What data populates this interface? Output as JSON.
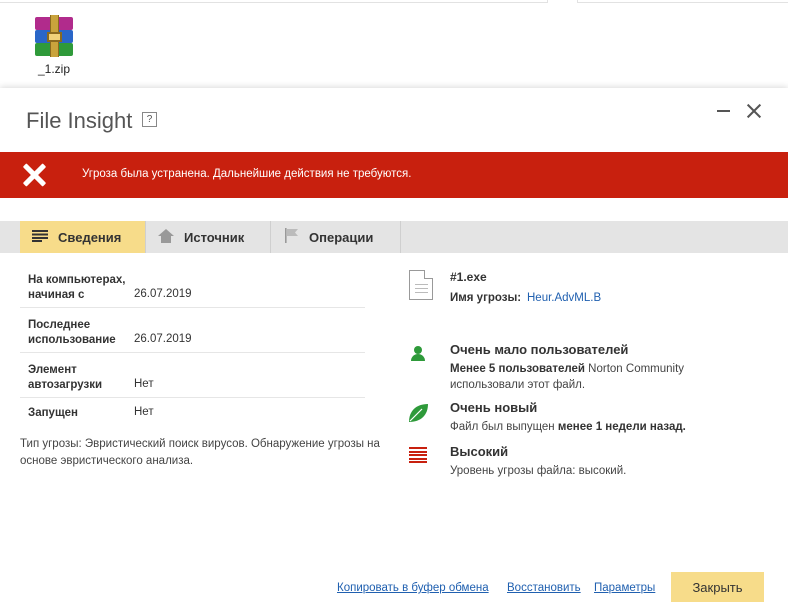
{
  "desktop": {
    "file_name": "_1.zip",
    "file_icon": "winrar-archive-icon"
  },
  "dialog": {
    "title": "File Insight",
    "help": "?",
    "alert_text": "Угроза была устранена. Дальнейшие действия не требуются.",
    "alert_color": "#c8200e",
    "tabs": [
      {
        "label": "Сведения",
        "icon": "list-icon",
        "active": true
      },
      {
        "label": "Источник",
        "icon": "home-icon"
      },
      {
        "label": "Операции",
        "icon": "flag-icon"
      }
    ],
    "details": [
      {
        "label_line1": "На компьютерах,",
        "label_line2": "начиная с",
        "value": "26.07.2019"
      },
      {
        "label_line1": "Последнее",
        "label_line2": "использование",
        "value": "26.07.2019"
      },
      {
        "label_line1": "Элемент",
        "label_line2": "автозагрузки",
        "value": "Нет"
      },
      {
        "label_line1": "Запущен",
        "label_line2": "",
        "value": "Нет"
      }
    ],
    "threat_note": "Тип угрозы: Эвристический поиск вирусов. Обнаружение угрозы на основе эвристического анализа.",
    "file": {
      "name": "#1.exe",
      "threat_label": "Имя угрозы:",
      "threat_name": "Heur.AdvML.B"
    },
    "indicators": [
      {
        "icon": "user-icon",
        "heading": "Очень мало пользователей",
        "desc_bold": "Менее 5 пользователей",
        "desc": " Norton Community использовали этот файл.",
        "color": "#2e9a3a"
      },
      {
        "icon": "leaf-icon",
        "heading": "Очень новый",
        "desc": "Файл был выпущен ",
        "desc_bold": "менее 1 недели назад.",
        "color": "#2e9a3a"
      },
      {
        "icon": "threat-bars-icon",
        "heading": "Высокий",
        "desc": "Уровень угрозы файла: высокий.",
        "color": "#c8200e"
      }
    ],
    "footer": {
      "copy": "Копировать в буфер обмена",
      "restore": "Восстановить",
      "params": "Параметры",
      "close": "Закрыть"
    },
    "accent_color": "#f7dc8a"
  }
}
